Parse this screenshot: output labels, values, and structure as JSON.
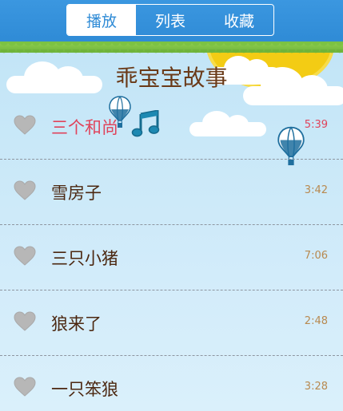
{
  "header": {
    "tabs": [
      {
        "label": "播放",
        "active": true
      },
      {
        "label": "列表",
        "active": false
      },
      {
        "label": "收藏",
        "active": false
      }
    ]
  },
  "title": "乖宝宝故事",
  "stories": [
    {
      "name": "三个和尚",
      "duration": "5:39",
      "playing": true,
      "icon": "music-note-icon"
    },
    {
      "name": "雪房子",
      "duration": "3:42",
      "playing": false
    },
    {
      "name": "三只小猪",
      "duration": "7:06",
      "playing": false
    },
    {
      "name": "狼来了",
      "duration": "2:48",
      "playing": false
    },
    {
      "name": "一只笨狼",
      "duration": "3:28",
      "playing": false
    }
  ],
  "colors": {
    "header_blue": "#2f8bd6",
    "playing_red": "#e0435b",
    "title_brown": "#6a3a18",
    "duration_tan": "#b8894f",
    "heart_gray": "#b7b7b7"
  }
}
